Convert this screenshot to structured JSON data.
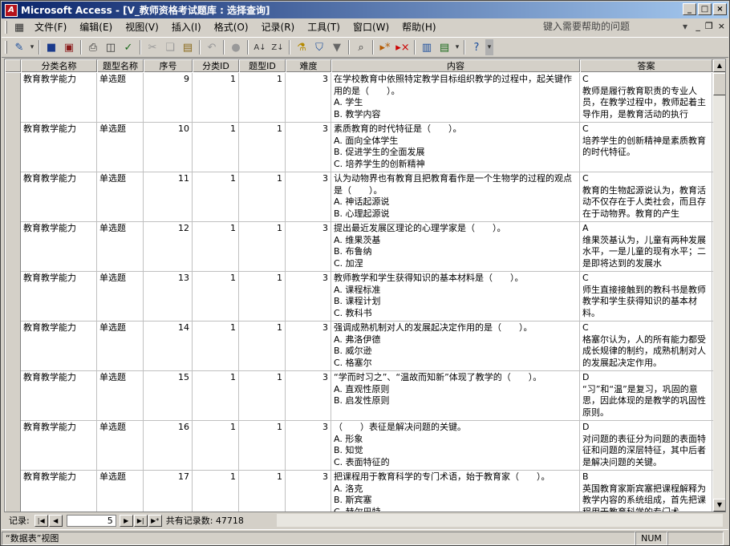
{
  "window": {
    "title": "Microsoft Access - [V_教师资格考试题库 : 选择查询]",
    "app_icon": "access-app-icon"
  },
  "menu": {
    "items": [
      "文件(F)",
      "编辑(E)",
      "视图(V)",
      "插入(I)",
      "格式(O)",
      "记录(R)",
      "工具(T)",
      "窗口(W)",
      "帮助(H)"
    ],
    "ask_placeholder": "键入需要帮助的问题"
  },
  "columns": [
    "分类名称",
    "题型名称",
    "序号",
    "分类ID",
    "题型ID",
    "难度",
    "内容",
    "答案"
  ],
  "rows": [
    {
      "cat": "教育教学能力",
      "type": "单选题",
      "seq": "9",
      "catid": "1",
      "typeid": "1",
      "diff": "3",
      "content": "在学校教育中依照特定教学目标组织教学的过程中，起关键作用的是（　　）。\nA. 学生\nB. 教学内容",
      "answer": "C\n教师是履行教育职责的专业人员，在教学过程中，教师起着主导作用，是教育活动的执行"
    },
    {
      "cat": "教育教学能力",
      "type": "单选题",
      "seq": "10",
      "catid": "1",
      "typeid": "1",
      "diff": "3",
      "content": "素质教育的时代特征是（　　）。\nA. 面向全体学生\nB. 促进学生的全面发展\nC. 培养学生的创新精神",
      "answer": "C\n培养学生的创新精神是素质教育的时代特征。"
    },
    {
      "cat": "教育教学能力",
      "type": "单选题",
      "seq": "11",
      "catid": "1",
      "typeid": "1",
      "diff": "3",
      "content": "认为动物界也有教育且把教育看作是一个生物学的过程的观点是（　　）。\nA. 神话起源说\nB. 心理起源说",
      "answer": "C\n教育的生物起源说认为，教育活动不仅存在于人类社会，而且存在于动物界。教育的产生"
    },
    {
      "cat": "教育教学能力",
      "type": "单选题",
      "seq": "12",
      "catid": "1",
      "typeid": "1",
      "diff": "3",
      "content": "提出最近发展区理论的心理学家是（　　）。\nA. 维果茨基\nB. 布鲁纳\nC. 加涅",
      "answer": "A\n维果茨基认为，儿童有两种发展水平，一是儿童的现有水平；二是即将达到的发展水"
    },
    {
      "cat": "教育教学能力",
      "type": "单选题",
      "seq": "13",
      "catid": "1",
      "typeid": "1",
      "diff": "3",
      "content": "教师教学和学生获得知识的基本材料是（　　）。\nA. 课程标准\nB. 课程计划\nC. 教科书",
      "answer": "C\n师生直接接触到的教科书是教师教学和学生获得知识的基本材料。"
    },
    {
      "cat": "教育教学能力",
      "type": "单选题",
      "seq": "14",
      "catid": "1",
      "typeid": "1",
      "diff": "3",
      "content": "强调成熟机制对人的发展起决定作用的是（　　）。\nA. 弗洛伊德\nB. 威尔逊\nC. 格塞尔",
      "answer": "C\n格塞尔认为，人的所有能力都受成长规律的制约，成熟机制对人的发展起决定作用。"
    },
    {
      "cat": "教育教学能力",
      "type": "单选题",
      "seq": "15",
      "catid": "1",
      "typeid": "1",
      "diff": "3",
      "content": "“学而时习之”、“温故而知新”体现了教学的（　　）。\nA. 直观性原则\nB. 启发性原则",
      "answer": "D\n“习”和“温”是复习，巩固的意思，因此体现的是教学的巩固性原则。"
    },
    {
      "cat": "教育教学能力",
      "type": "单选题",
      "seq": "16",
      "catid": "1",
      "typeid": "1",
      "diff": "3",
      "content": "（　　）表征是解决问题的关键。\nA. 形象\nB. 知觉\nC. 表面特征的",
      "answer": "D\n对问题的表征分为问题的表面特征和问题的深层特征，其中后者是解决问题的关键。"
    },
    {
      "cat": "教育教学能力",
      "type": "单选题",
      "seq": "17",
      "catid": "1",
      "typeid": "1",
      "diff": "3",
      "content": "把课程用于教育科学的专门术语，始于教育家（　　）。\nA. 洛克\nB. 斯宾塞\nC. 赫尔巴特",
      "answer": "B\n英国教育家斯宾塞把课程解释为教学内容的系统组成，首先把课程用于教育科学的专门术"
    }
  ],
  "nav": {
    "record_label": "记录:",
    "current": "5",
    "total_label": "共有记录数: 47718"
  },
  "status": {
    "view": "“数据表”视图",
    "num": "NUM"
  }
}
